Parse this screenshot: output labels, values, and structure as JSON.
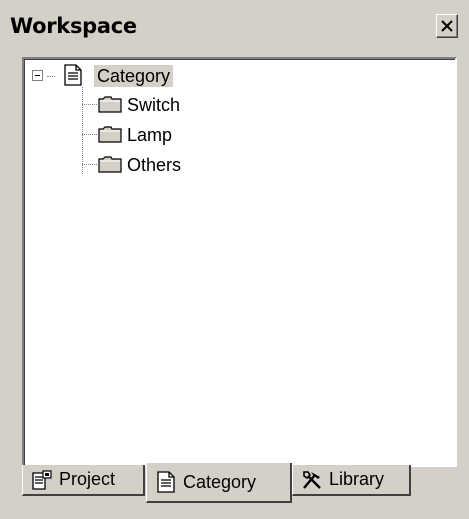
{
  "window": {
    "title": "Workspace"
  },
  "tree": {
    "root": {
      "label": "Category",
      "icon": "document-icon",
      "expanded": true
    },
    "children": [
      {
        "label": "Switch",
        "icon": "folder-icon"
      },
      {
        "label": "Lamp",
        "icon": "folder-icon"
      },
      {
        "label": "Others",
        "icon": "folder-icon"
      }
    ]
  },
  "tabs": [
    {
      "label": "Project",
      "icon": "project-icon",
      "active": false
    },
    {
      "label": "Category",
      "icon": "document-icon",
      "active": true
    },
    {
      "label": "Library",
      "icon": "tools-icon",
      "active": false
    }
  ],
  "colors": {
    "window_bg": "#d4d0c8",
    "panel_bg": "#ffffff",
    "selection_bg": "#d4d0c8"
  }
}
